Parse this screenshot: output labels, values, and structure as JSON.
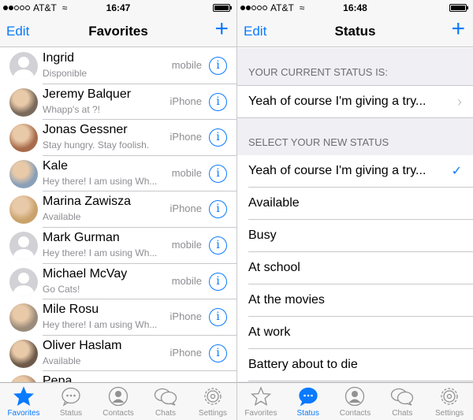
{
  "left": {
    "statusbar": {
      "carrier": "AT&T",
      "time": "16:47"
    },
    "navbar": {
      "edit": "Edit",
      "title": "Favorites",
      "add": "+"
    },
    "contacts": [
      {
        "name": "Ingrid",
        "status": "Disponible",
        "type": "mobile",
        "avatar": "placeholder"
      },
      {
        "name": "Jeremy Balquer",
        "status": "Whapp's at ?!",
        "type": "iPhone",
        "avatar": "photo"
      },
      {
        "name": "Jonas Gessner",
        "status": "Stay hungry. Stay foolish.",
        "type": "iPhone",
        "avatar": "photo"
      },
      {
        "name": "Kale",
        "status": "Hey there! I am using Wh...",
        "type": "mobile",
        "avatar": "photo"
      },
      {
        "name": "Marina Zawisza",
        "status": "Available",
        "type": "iPhone",
        "avatar": "photo"
      },
      {
        "name": "Mark Gurman",
        "status": "Hey there! I am using Wh...",
        "type": "mobile",
        "avatar": "placeholder"
      },
      {
        "name": "Michael McVay",
        "status": "Go Cats!",
        "type": "mobile",
        "avatar": "placeholder"
      },
      {
        "name": "Mile Rosu",
        "status": "Hey there! I am using Wh...",
        "type": "iPhone",
        "avatar": "photo"
      },
      {
        "name": "Oliver Haslam",
        "status": "Available",
        "type": "iPhone",
        "avatar": "photo"
      },
      {
        "name": "Pepa",
        "status": "",
        "type": "",
        "avatar": "photo"
      }
    ],
    "tabs": [
      {
        "label": "Favorites",
        "icon": "star-icon",
        "active": true
      },
      {
        "label": "Status",
        "icon": "speech-bubble-icon",
        "active": false
      },
      {
        "label": "Contacts",
        "icon": "person-icon",
        "active": false
      },
      {
        "label": "Chats",
        "icon": "chats-icon",
        "active": false
      },
      {
        "label": "Settings",
        "icon": "gear-icon",
        "active": false
      }
    ]
  },
  "right": {
    "statusbar": {
      "carrier": "AT&T",
      "time": "16:48"
    },
    "navbar": {
      "edit": "Edit",
      "title": "Status",
      "add": "+"
    },
    "current_header": "YOUR CURRENT STATUS IS:",
    "current_status": "Yeah of course I'm giving a try...",
    "select_header": "SELECT YOUR NEW STATUS",
    "options": [
      {
        "label": "Yeah of course I'm giving a try...",
        "selected": true
      },
      {
        "label": "Available",
        "selected": false
      },
      {
        "label": "Busy",
        "selected": false
      },
      {
        "label": "At school",
        "selected": false
      },
      {
        "label": "At the movies",
        "selected": false
      },
      {
        "label": "At work",
        "selected": false
      },
      {
        "label": "Battery about to die",
        "selected": false
      }
    ],
    "tabs": [
      {
        "label": "Favorites",
        "icon": "star-icon",
        "active": false
      },
      {
        "label": "Status",
        "icon": "speech-bubble-icon",
        "active": true
      },
      {
        "label": "Contacts",
        "icon": "person-icon",
        "active": false
      },
      {
        "label": "Chats",
        "icon": "chats-icon",
        "active": false
      },
      {
        "label": "Settings",
        "icon": "gear-icon",
        "active": false
      }
    ]
  },
  "colors": {
    "accent": "#0a7aff",
    "secondary_text": "#8e8e93",
    "group_bg": "#efeff4"
  }
}
